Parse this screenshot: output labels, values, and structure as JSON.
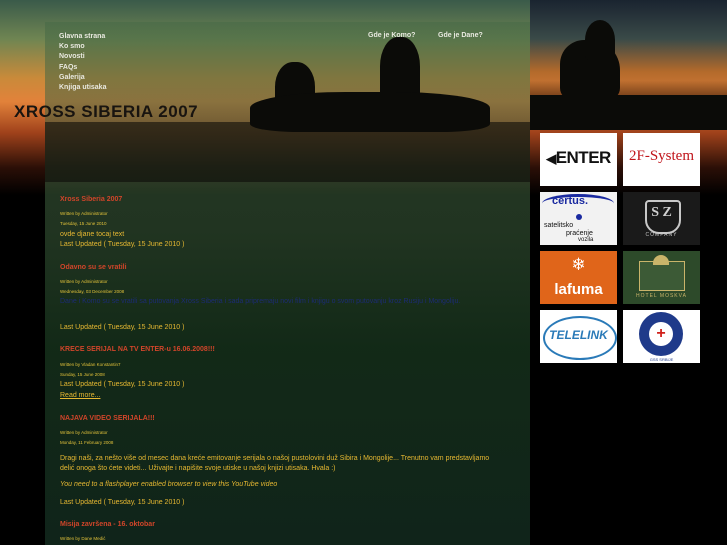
{
  "header": {
    "logo_text": "XROSS SIBERIA 2007"
  },
  "nav": {
    "items": [
      "Glavna strana",
      "Ko smo",
      "Novosti",
      "FAQs",
      "Galerija",
      "Knjiga utisaka"
    ],
    "top_links": [
      "Gde je Komo?",
      "Gde je Dane?"
    ]
  },
  "articles": [
    {
      "title": "Xross Siberia 2007",
      "author": "Written by Administrator",
      "date": "Tuesday, 15 June 2010",
      "body": "ovde djane tocaj text",
      "updated": "Last Updated ( Tuesday, 15 June 2010 )"
    },
    {
      "title": "Odavno su se vratili",
      "author": "Written by Administrator",
      "date": "Wednesday, 03 December 2008",
      "body": "Dane i Komo su se vratili sa putovanja Xross Siberia i sada pripremaju novi film i knjigu o svom putovanju kroz Rusiju i Mongoliju.",
      "updated": "Last Updated ( Tuesday, 15 June 2010 )"
    },
    {
      "title": "KRECE SERIJAL NA TV ENTER-u 16.06.2008!!!",
      "author": "Written by Vladan Konstantin7",
      "date": "Sunday, 15 June 2008",
      "updated": "Last Updated ( Tuesday, 15 June 2010 )",
      "read_more": "Read more..."
    },
    {
      "title": "NAJAVA VIDEO SERIJALA!!!",
      "author": "Written by Administrator",
      "date": "Monday, 11 February 2008",
      "body": "Dragi naši, za nešto više od mesec dana kreće emitovanje serijala o našoj pustolovini duž Sibira i Mongolije... Trenutno vam predstavljamo delić onoga što ćete videti... Uživajte i napišite svoje utiske u našoj knjizi utisaka. Hvala :)",
      "flash_note": "You need to a flashplayer enabled browser to view this YouTube video",
      "updated": "Last Updated ( Tuesday, 15 June 2010 )"
    },
    {
      "title": "Misija završena - 16. oktobar",
      "author": "Written by Dane Medić"
    }
  ],
  "sponsors": {
    "enter": "ENTER",
    "twoF": "2F-System",
    "certus_name": "certus.",
    "certus_line1": "satelitsko",
    "certus_line2": "praćenje",
    "certus_line3": "vozila",
    "sz": "S Z",
    "sz_company": "COMPANY",
    "lafuma": "lafuma",
    "moskva": "HOTEL MOSKVA",
    "telelink": "TELELINK",
    "gss": "GSS SRBIJE"
  },
  "colors": {
    "title_red": "#d0452a",
    "text_yellow": "#e6b832",
    "lafuma_orange": "#e0651a",
    "moskva_green": "#2d4a2a"
  }
}
